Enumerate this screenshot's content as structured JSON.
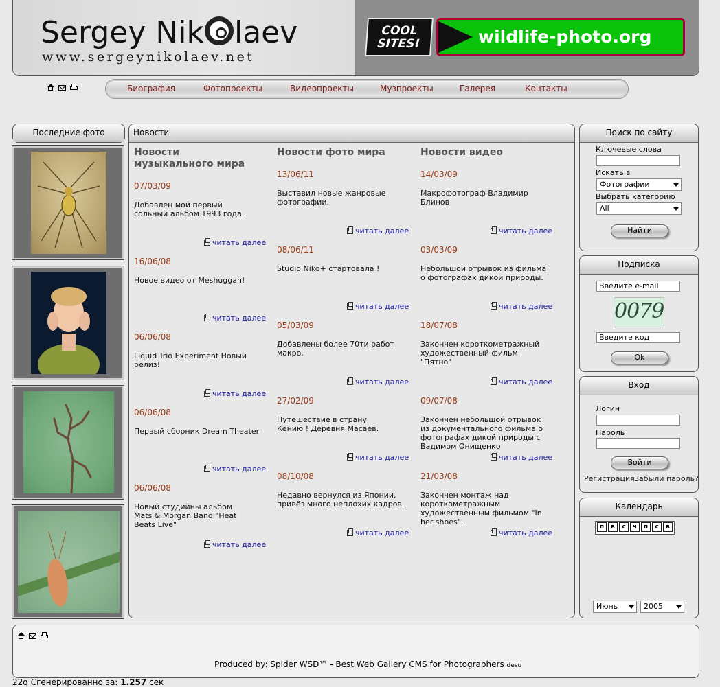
{
  "header": {
    "name_part1": "Sergey Nik",
    "name_part2": "laev",
    "url": "www.sergeynikolaev.net",
    "cool_sites_line1": "COOL",
    "cool_sites_line2": "SITES!",
    "banner_text": "wildlife-photo.org"
  },
  "nav": [
    "Биография",
    "Фотопроекты",
    "Видеопроекты",
    "Музпроекты",
    "Галерея",
    "Контакты"
  ],
  "latest_photos": {
    "title": "Последние фото"
  },
  "news": {
    "title": "Новости",
    "read_more": "читать далее",
    "columns": [
      {
        "title": "Новости музыкального мира",
        "items": [
          {
            "date": "07/03/09",
            "text": "Добавлен мой первый сольный альбом 1993 года."
          },
          {
            "date": "16/06/08",
            "text": "Новое видео от Meshuggah!"
          },
          {
            "date": "06/06/08",
            "text": "Liquid Trio Experiment Новый релиз!"
          },
          {
            "date": "06/06/08",
            "text": "Первый сборник Dream Theater"
          },
          {
            "date": "06/06/08",
            "text": "Новый студийны альбом Mats & Morgan Band \"Heat Beats Live\""
          }
        ]
      },
      {
        "title": "Новости фото мира",
        "items": [
          {
            "date": "13/06/11",
            "text": "Выставил новые жанровые фотографии."
          },
          {
            "date": "08/06/11",
            "text": "Studio Niko+ стартовала !"
          },
          {
            "date": "05/03/09",
            "text": "Добавлены более 70ти работ макро."
          },
          {
            "date": "27/02/09",
            "text": "Путешествие в страну Кению ! Деревня Масаев."
          },
          {
            "date": "08/10/08",
            "text": "Недавно вернулся из Японии, привёз много неплохих кадров."
          }
        ]
      },
      {
        "title": "Новости видео",
        "items": [
          {
            "date": "14/03/09",
            "text": "Макрофотограф Владимир Блинов"
          },
          {
            "date": "03/03/09",
            "text": "Небольшой отрывок из фильма о фотографах дикой природы."
          },
          {
            "date": "18/07/08",
            "text": "Закончен короткометражный художественный фильм \"Пятно\""
          },
          {
            "date": "09/07/08",
            "text": "Закончен небольшой отрывок из документального фильма о фотографах дикой природы с Вадимом Онищенко"
          },
          {
            "date": "21/03/08",
            "text": "Закончен монтаж над короткометражным художественным фильмом \"In her shoes\"."
          }
        ]
      }
    ]
  },
  "search": {
    "title": "Поиск по сайту",
    "keywords_label": "Ключевые слова",
    "keywords_value": "",
    "search_in_label": "Искать в",
    "search_in_value": "Фотографии",
    "category_label": "Выбрать категорию",
    "category_value": "All",
    "button": "Найти"
  },
  "subscribe": {
    "title": "Подписка",
    "email_placeholder": "Введите e-mail",
    "captcha": "0079",
    "code_placeholder": "Введите код",
    "button": "Ok"
  },
  "login": {
    "title": "Вход",
    "login_label": "Логин",
    "password_label": "Пароль",
    "button": "Войти",
    "register": "Регистрация",
    "forgot": "Забыли пароль?"
  },
  "calendar": {
    "title": "Календарь",
    "days": [
      "п",
      "в",
      "с",
      "ч",
      "п",
      "с",
      "в"
    ],
    "month": "Июнь",
    "year": "2005"
  },
  "footer": {
    "produced": "Produced by: Spider WSD™ - Best Web Gallery CMS for Photographers",
    "produced_small": "desu",
    "generated_prefix": "22q Сгенерированно за:",
    "generated_time": "1.257",
    "generated_suffix": "сек"
  }
}
